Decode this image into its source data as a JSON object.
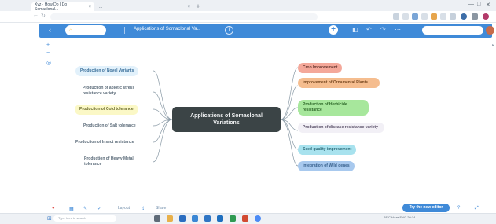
{
  "browser": {
    "tabs": [
      {
        "label": "Xyz · How Do I Do Somaclonal...",
        "active": true
      },
      {
        "label": "...",
        "active": false
      }
    ],
    "new_tab": "+",
    "url": "",
    "window_controls": [
      "—",
      "□",
      "✕"
    ]
  },
  "app_header": {
    "back_icon": "‹",
    "home_label": "",
    "doc_title": "Applications of Somaclonal Va...",
    "info_icon": "i",
    "add_icon": "+"
  },
  "mindmap": {
    "central": "Applications of Somaclonal Variations",
    "left_nodes": [
      {
        "label": "Production of Novel Variants",
        "style": "l-blue"
      },
      {
        "label": "Production of abiotic stress resistance variety",
        "style": "l-plain"
      },
      {
        "label": "Production of Cold tolerance",
        "style": "l-yellow"
      },
      {
        "label": "Production of Salt tolerance",
        "style": "l-plain"
      },
      {
        "label": "Production of Insect resistance",
        "style": "l-plain"
      },
      {
        "label": "Production of Heavy Metal tolerance",
        "style": "l-plain"
      }
    ],
    "right_nodes": [
      {
        "label": "Crop Improvement",
        "style": "r-salmon"
      },
      {
        "label": "Improvement of Ornamental Plants",
        "style": "r-orange"
      },
      {
        "label": "Production of Herbicide resistance",
        "style": "r-green"
      },
      {
        "label": "Production of disease resistance variety",
        "style": "r-lav"
      },
      {
        "label": "Seed quality improvement",
        "style": "r-cyan"
      },
      {
        "label": "Integration of Wild genes",
        "style": "r-blue"
      }
    ]
  },
  "bottom_toolbar": {
    "label_1": "Layout",
    "label_2": "Share",
    "try_button": "Try the new editor"
  },
  "taskbar": {
    "search_placeholder": "Type here to search",
    "tray": "28°C Haze  ENG  20:14"
  },
  "colors": {
    "header_blue": "#3f8ad8",
    "central_node": "#3b4446"
  }
}
